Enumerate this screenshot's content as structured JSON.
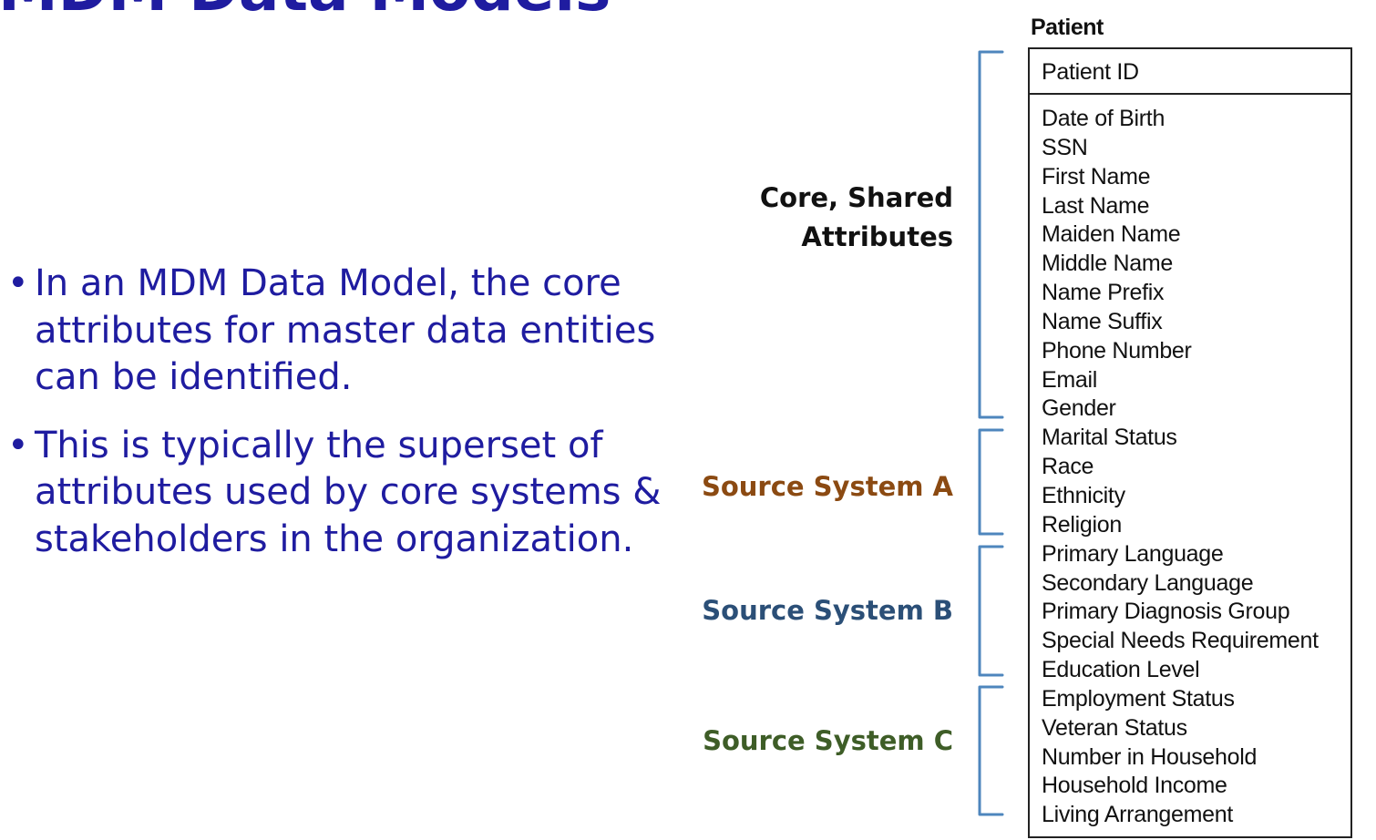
{
  "slide": {
    "title": "MDM Data Models"
  },
  "bullets": [
    {
      "text": "In an MDM Data Model, the core attributes for master data entities can be identified."
    },
    {
      "text": "This is typically the superset of attributes used by core systems & stakeholders in the organization."
    }
  ],
  "bullet_symbol": "•",
  "groups": {
    "core": {
      "line1": "Core, Shared",
      "line2": "Attributes"
    },
    "source_a": {
      "label": "Source System A",
      "color": "#8b4a12"
    },
    "source_b": {
      "label": "Source System B",
      "color": "#2b4f77"
    },
    "source_c": {
      "label": "Source System C",
      "color": "#3e5d27"
    }
  },
  "entity": {
    "name": "Patient",
    "primary_key": "Patient ID",
    "attributes": [
      "Date of Birth",
      "SSN",
      "First Name",
      "Last Name",
      "Maiden Name",
      "Middle Name",
      "Name Prefix",
      "Name Suffix",
      "Phone Number",
      "Email",
      "Gender",
      "Marital Status",
      "Race",
      "Ethnicity",
      "Religion",
      "Primary Language",
      "Secondary Language",
      "Primary Diagnosis Group",
      "Special Needs Requirement",
      "Education Level",
      "Employment Status",
      "Veteran Status",
      "Number in Household",
      "Household Income",
      "Living Arrangement"
    ]
  },
  "colors": {
    "body_text": "#1f1ca0",
    "bracket": "#4e86bd"
  }
}
